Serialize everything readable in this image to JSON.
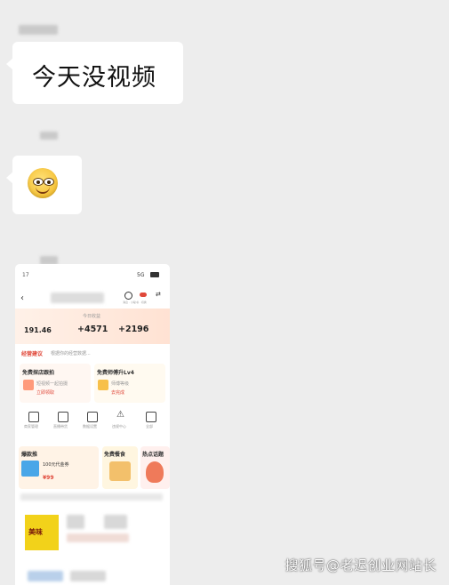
{
  "chat": {
    "messages": [
      {
        "type": "text",
        "text": "今天没视频"
      },
      {
        "type": "emoji",
        "emoji": "smirk-face"
      },
      {
        "type": "image",
        "content": "phone-screenshot"
      }
    ]
  },
  "phone": {
    "status": {
      "signal": "5G"
    },
    "stats": {
      "value1": "191.46",
      "value2": "+4571",
      "value3": "+2196",
      "caption": "今日收益"
    },
    "advice": {
      "label": "经营建议",
      "text": "根据你的经营数据..."
    },
    "tasks": [
      {
        "title": "免费探店跟拍",
        "sub": "短视频一起拍摄",
        "badge": "立即领取"
      },
      {
        "title": "免费师傅升Lv4",
        "sub": "师傅等级",
        "badge": "去完成"
      }
    ],
    "tools": [
      {
        "label": "商家管理",
        "icon": "shop-icon"
      },
      {
        "label": "直播带货",
        "icon": "video-icon"
      },
      {
        "label": "数据设置",
        "icon": "doc-icon"
      },
      {
        "label": "违规中心",
        "icon": "warning-icon"
      },
      {
        "label": "全部",
        "icon": "grid-icon"
      }
    ],
    "promos": [
      {
        "title": "爆款推",
        "sub": "100元代金券",
        "price": "¥99"
      },
      {
        "title": "免费餐食",
        "sub": ""
      },
      {
        "title": "热点话题",
        "sub": ""
      }
    ],
    "thumb_text": "美味"
  },
  "watermark": "搜狐号@老迟创业网站长"
}
